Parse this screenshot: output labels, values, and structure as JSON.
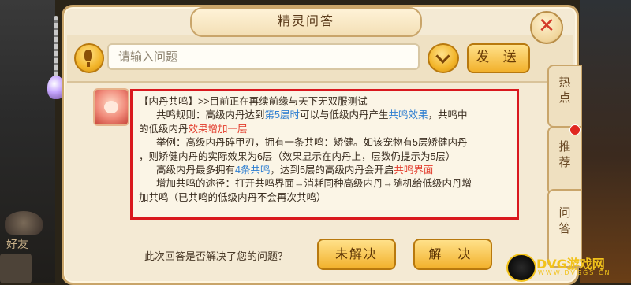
{
  "dialog": {
    "title": "精灵问答"
  },
  "search": {
    "placeholder": "请输入问题",
    "send_label": "发 送"
  },
  "answer": {
    "line1": "【内丹共鸣】>>目前正在再续前缘与天下无双服测试",
    "line2_a": "共鸣规则：高级内丹达到",
    "line2_b": "第5层时",
    "line2_c": "可以与低级内丹产生",
    "line2_d": "共鸣效果",
    "line2_e": "，共鸣中",
    "line3_a": "的低级内丹",
    "line3_b": "效果增加一层",
    "line4": "举例：高级内丹碎甲刃，拥有一条共鸣：矫健。如该宠物有5层矫健内丹",
    "line5": "，则矫健内丹的实际效果为6层（效果显示在内丹上，层数仍提示为5层）",
    "line6_a": "高级内丹最多拥有",
    "line6_b": "4条共鸣",
    "line6_c": "，达到5层的高级内丹会开启",
    "line6_d": "共鸣界面",
    "line7": "增加共鸣的途径：打开共鸣界面→消耗同种高级内丹→随机给低级内丹增",
    "line8": "加共鸣（已共鸣的低级内丹不会再次共鸣）"
  },
  "feedback": {
    "question": "此次回答是否解决了您的问题？",
    "unsolved_label": "未解决",
    "solved_label": "解 决"
  },
  "tabs": [
    {
      "label1": "热",
      "label2": "点"
    },
    {
      "label1": "推",
      "label2": "荐"
    },
    {
      "label1": "问",
      "label2": "答"
    }
  ],
  "background": {
    "friend_label": "好友"
  },
  "watermark": {
    "text": "DVG游戏网",
    "sub": "WWW.DVGGS.CN"
  },
  "colors": {
    "answer_border": "#d9181e",
    "highlight_blue": "#2f7fd1",
    "highlight_red": "#e23a2a",
    "button_gold": "#f2b12c"
  }
}
